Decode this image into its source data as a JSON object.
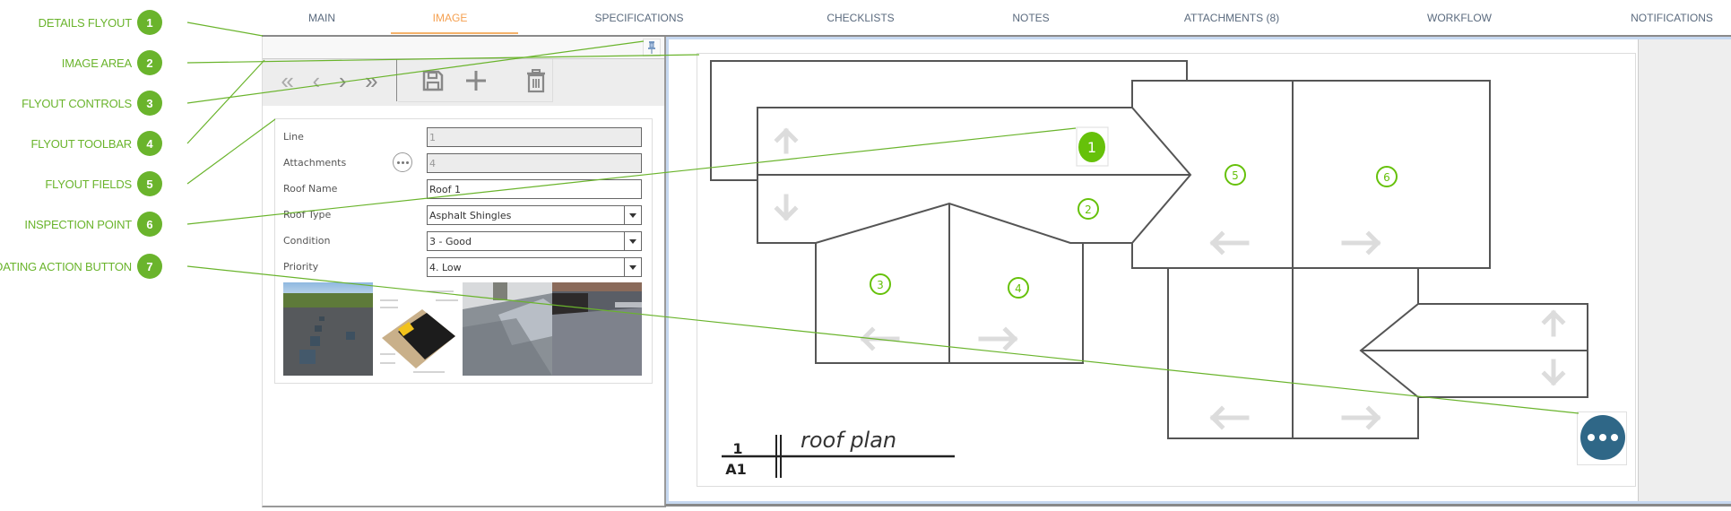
{
  "callouts": [
    {
      "num": "1",
      "label": "DETAILS FLYOUT"
    },
    {
      "num": "2",
      "label": "IMAGE AREA"
    },
    {
      "num": "3",
      "label": "FLYOUT CONTROLS"
    },
    {
      "num": "4",
      "label": "FLYOUT TOOLBAR"
    },
    {
      "num": "5",
      "label": "FLYOUT FIELDS"
    },
    {
      "num": "6",
      "label": "INSPECTION POINT"
    },
    {
      "num": "7",
      "label": "FLOATING ACTION BUTTON"
    }
  ],
  "tabs": [
    {
      "label": "MAIN",
      "active": false
    },
    {
      "label": "IMAGE",
      "active": true
    },
    {
      "label": "SPECIFICATIONS",
      "active": false
    },
    {
      "label": "CHECKLISTS",
      "active": false
    },
    {
      "label": "NOTES",
      "active": false
    },
    {
      "label": "ATTACHMENTS (8)",
      "active": false
    },
    {
      "label": "WORKFLOW",
      "active": false
    },
    {
      "label": "NOTIFICATIONS",
      "active": false
    }
  ],
  "flyout": {
    "pin_icon": "pushpin-icon",
    "toolbar": {
      "nav": [
        {
          "icon": "first-record-icon",
          "glyph": "«"
        },
        {
          "icon": "previous-record-icon",
          "glyph": "‹"
        },
        {
          "icon": "next-record-icon",
          "glyph": "›"
        },
        {
          "icon": "last-record-icon",
          "glyph": "»"
        }
      ],
      "actions": [
        "save-icon",
        "add-icon",
        "delete-icon"
      ]
    },
    "fields": [
      {
        "label": "Line",
        "value": "1",
        "readonly": true,
        "type": "text"
      },
      {
        "label": "Attachments",
        "value": "4",
        "readonly": true,
        "type": "text",
        "has_more_button": true
      },
      {
        "label": "Roof Name",
        "value": "Roof 1",
        "readonly": false,
        "type": "text"
      },
      {
        "label": "Roof Type",
        "value": "Asphalt Shingles",
        "readonly": false,
        "type": "select"
      },
      {
        "label": "Condition",
        "value": "3 - Good",
        "readonly": false,
        "type": "select"
      },
      {
        "label": "Priority",
        "value": "4. Low",
        "readonly": false,
        "type": "select"
      }
    ],
    "thumbnails": [
      {
        "name": "flat-roof-with-vents-photo"
      },
      {
        "name": "roof-membrane-diagram"
      },
      {
        "name": "metal-roof-skylight-photo"
      },
      {
        "name": "flat-membrane-roof-photo"
      }
    ]
  },
  "drawing": {
    "title_number": "1",
    "title_sheet": "A1",
    "title": "roof plan",
    "inspection_points": [
      {
        "num": "1",
        "selected": true
      },
      {
        "num": "2",
        "selected": false
      },
      {
        "num": "3",
        "selected": false
      },
      {
        "num": "4",
        "selected": false
      },
      {
        "num": "5",
        "selected": false
      },
      {
        "num": "6",
        "selected": false
      }
    ],
    "accent_color": "#66c10a"
  },
  "fab": {
    "icon": "more-horizontal-icon",
    "color": "#2f6787"
  }
}
